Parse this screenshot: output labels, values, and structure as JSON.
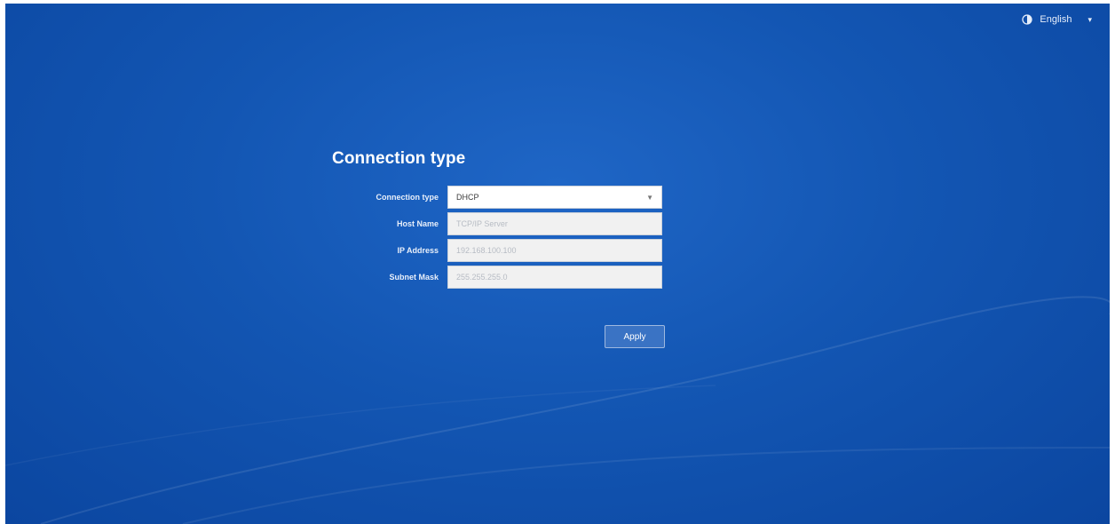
{
  "header": {
    "language_label": "English",
    "globe_icon": "globe-icon",
    "caret_icon": "chevron-down-icon"
  },
  "form": {
    "title": "Connection type",
    "rows": [
      {
        "label": "Connection type",
        "value": "DHCP",
        "placeholder": ""
      },
      {
        "label": "Host Name",
        "value": "",
        "placeholder": "TCP/IP Server"
      },
      {
        "label": "IP Address",
        "value": "",
        "placeholder": "192.168.100.100"
      },
      {
        "label": "Subnet Mask",
        "value": "",
        "placeholder": "255.255.255.0"
      }
    ],
    "apply_label": "Apply"
  },
  "colors": {
    "background": "#1356b3",
    "field_disabled": "#f1f1f1",
    "button": "#3a73c4"
  }
}
